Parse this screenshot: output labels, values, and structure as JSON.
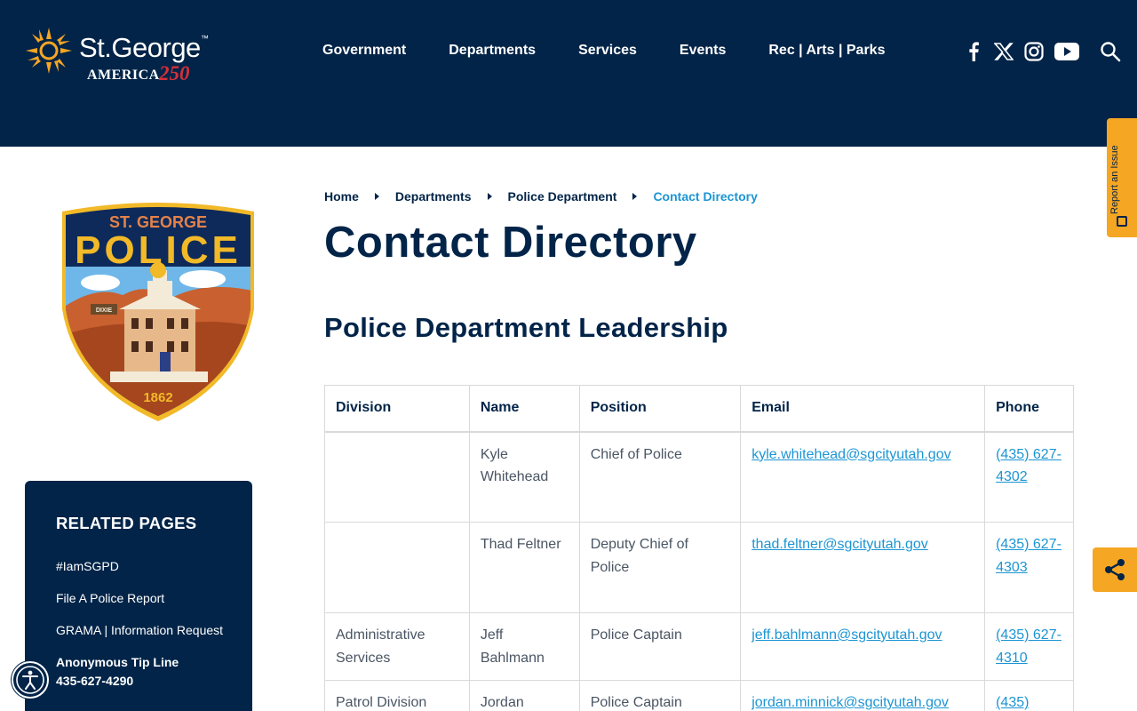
{
  "header": {
    "logo": {
      "name": "St.George",
      "tm": "™",
      "america": "AMERICA",
      "number": "250"
    },
    "nav": [
      "Government",
      "Departments",
      "Services",
      "Events",
      "Rec | Arts | Parks"
    ],
    "social_icons": [
      "facebook-icon",
      "x-twitter-icon",
      "instagram-icon",
      "youtube-icon"
    ],
    "search_icon": "search-icon"
  },
  "side_tabs": {
    "report": "Report an Issue",
    "share_icon": "share-icon"
  },
  "badge": {
    "top_text": "ST. GEORGE",
    "main_text": "POLICE",
    "sign_text": "DIXIE",
    "year": "1862"
  },
  "breadcrumb": {
    "items": [
      "Home",
      "Departments",
      "Police Department"
    ],
    "current": "Contact Directory"
  },
  "page": {
    "title": "Contact Directory",
    "section_title": "Police Department Leadership"
  },
  "table": {
    "headers": [
      "Division",
      "Name",
      "Position",
      "Email",
      "Phone"
    ],
    "rows": [
      {
        "division": "",
        "name": "Kyle Whitehead",
        "position": "Chief of Police",
        "email": "kyle.whitehead@sgcityutah.gov",
        "phone": "(435) 627-4302"
      },
      {
        "division": "",
        "name": "Thad Feltner",
        "position": "Deputy Chief of Police",
        "email": "thad.feltner@sgcityutah.gov",
        "phone": "(435) 627-4303"
      },
      {
        "division": "Administrative Services",
        "name": "Jeff Bahlmann",
        "position": "Police Captain",
        "email": "jeff.bahlmann@sgcityutah.gov",
        "phone": "(435) 627-4310"
      },
      {
        "division": "Patrol Division",
        "name": "Jordan",
        "position": "Police Captain",
        "email": "jordan.minnick@sgcityutah.gov",
        "phone": "(435)"
      }
    ]
  },
  "related": {
    "title": "RELATED PAGES",
    "items": [
      "#IamSGPD",
      "File A Police Report",
      "GRAMA | Information Request"
    ],
    "tip_line_label": "Anonymous Tip Line",
    "tip_line_number": "435-627-4290"
  },
  "accessibility_icon": "accessibility-icon",
  "colors": {
    "navy": "#022448",
    "accent": "#f5a623",
    "link": "#1c95d3"
  }
}
